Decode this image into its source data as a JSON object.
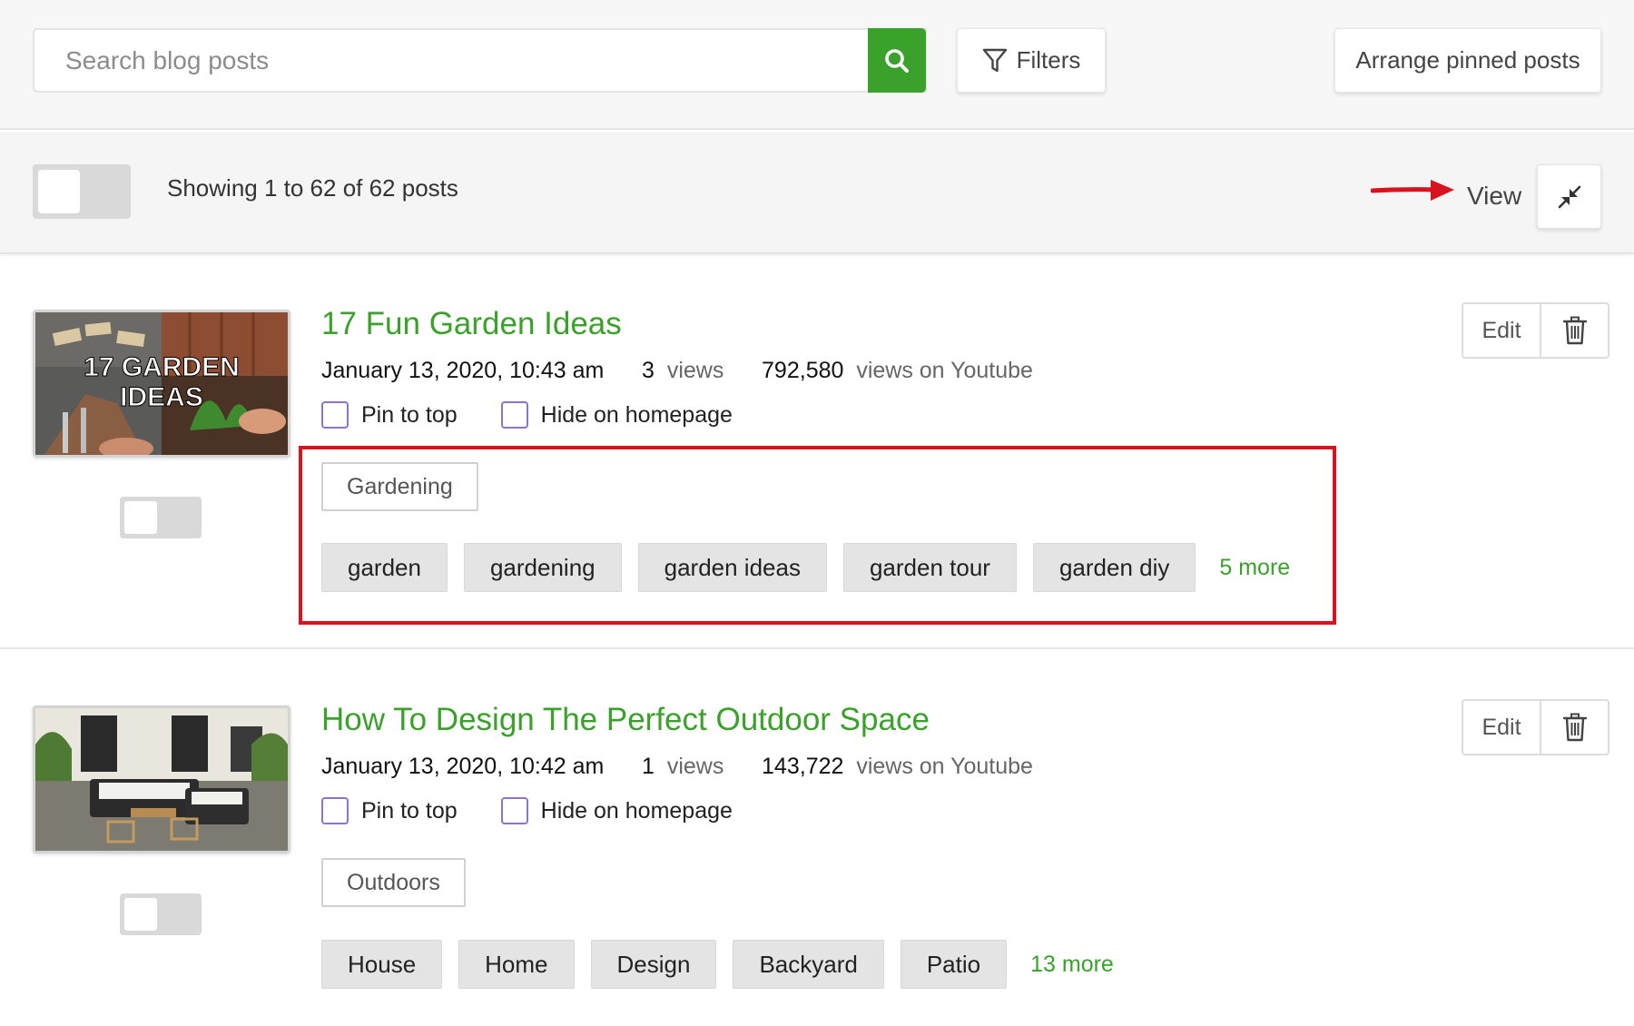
{
  "search": {
    "placeholder": "Search blog posts",
    "value": ""
  },
  "header": {
    "filters_label": "Filters",
    "arrange_label": "Arrange pinned posts"
  },
  "toolbar": {
    "showing_text": "Showing 1 to 62 of 62 posts",
    "view_label": "View"
  },
  "colors": {
    "accent": "#3aa12a",
    "highlight": "#d9121f",
    "checkbox_border": "#8d74c4"
  },
  "posts": [
    {
      "title": "17 Fun Garden Ideas",
      "date": "January 13, 2020, 10:43 am",
      "views_count": "3",
      "views_label": "views",
      "youtube_count": "792,580",
      "youtube_label": "views on Youtube",
      "pin_label": "Pin to top",
      "hide_label": "Hide on homepage",
      "category": "Gardening",
      "tags": [
        "garden",
        "gardening",
        "garden ideas",
        "garden tour",
        "garden diy"
      ],
      "more": "5 more",
      "edit_label": "Edit",
      "thumbnail_text": [
        "17 GARDEN",
        "IDEAS"
      ]
    },
    {
      "title": "How To Design The Perfect Outdoor Space",
      "date": "January 13, 2020, 10:42 am",
      "views_count": "1",
      "views_label": "views",
      "youtube_count": "143,722",
      "youtube_label": "views on Youtube",
      "pin_label": "Pin to top",
      "hide_label": "Hide on homepage",
      "category": "Outdoors",
      "tags": [
        "House",
        "Home",
        "Design",
        "Backyard",
        "Patio"
      ],
      "more": "13 more",
      "edit_label": "Edit"
    }
  ]
}
